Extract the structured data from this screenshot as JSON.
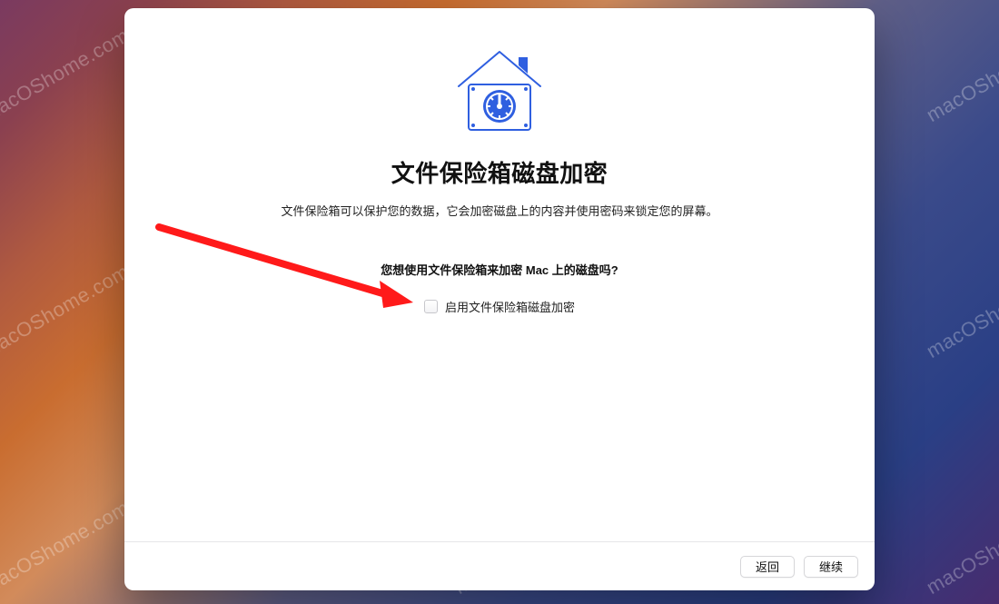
{
  "watermark_text": "macOShome.com",
  "dialog": {
    "title": "文件保险箱磁盘加密",
    "subtitle": "文件保险箱可以保护您的数据，它会加密磁盘上的内容并使用密码来锁定您的屏幕。",
    "question": "您想使用文件保险箱来加密 Mac 上的磁盘吗?",
    "checkbox_label": "启用文件保险箱磁盘加密"
  },
  "buttons": {
    "back": "返回",
    "continue": "继续"
  }
}
